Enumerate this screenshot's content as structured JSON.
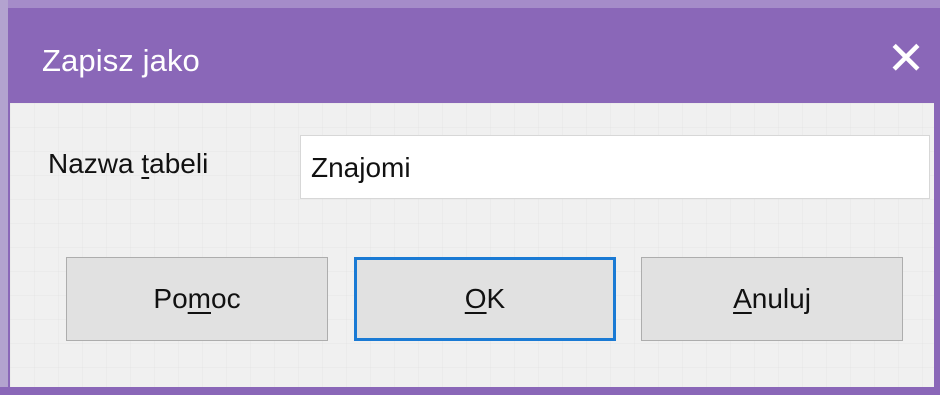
{
  "window": {
    "title": "Zapisz jako",
    "close_symbol": "✕"
  },
  "form": {
    "label_prefix": "Nazwa ",
    "label_mnemonic": "t",
    "label_suffix": "abeli",
    "value": "Znajomi"
  },
  "buttons": {
    "help_prefix": "Po",
    "help_mnemonic": "m",
    "help_suffix": "oc",
    "ok_mnemonic": "O",
    "ok_suffix": "K",
    "cancel_mnemonic": "A",
    "cancel_suffix": "nuluj"
  },
  "colors": {
    "titlebar": "#8a67b8",
    "dialog_background": "#f0f0f0",
    "focus_border": "#1a7ad4"
  },
  "icons": {
    "close": "close-icon"
  }
}
